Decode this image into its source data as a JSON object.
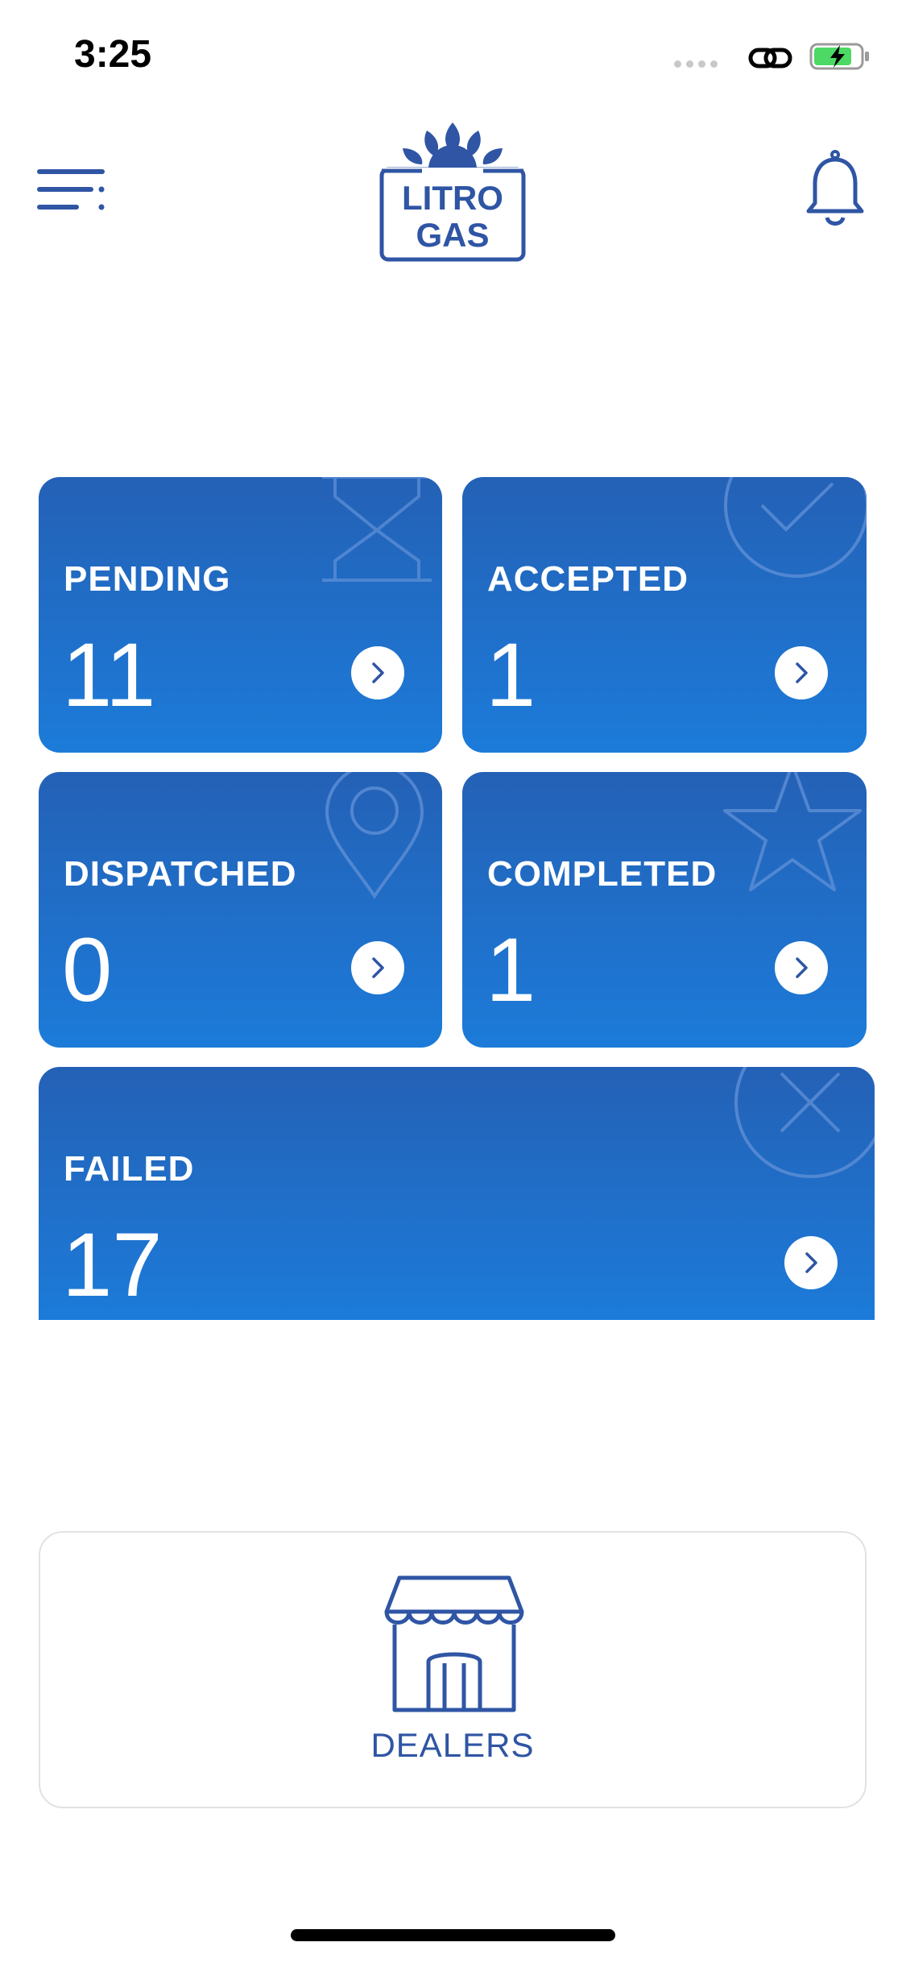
{
  "status_bar": {
    "time": "3:25"
  },
  "header": {
    "logo_text_line1": "LITRO",
    "logo_text_line2": "GAS",
    "menu_icon": "menu-icon",
    "notifications_icon": "bell-icon"
  },
  "tiles": [
    {
      "label": "PENDING",
      "count": "11",
      "icon": "hourglass-icon"
    },
    {
      "label": "ACCEPTED",
      "count": "1",
      "icon": "check-circle-icon"
    },
    {
      "label": "DISPATCHED",
      "count": "0",
      "icon": "map-pin-icon"
    },
    {
      "label": "COMPLETED",
      "count": "1",
      "icon": "star-icon"
    },
    {
      "label": "FAILED",
      "count": "17",
      "icon": "x-circle-icon"
    }
  ],
  "dealers": {
    "label": "DEALERS",
    "icon": "store-icon"
  },
  "colors": {
    "brand_blue": "#2f55a4",
    "tile_top": "#2461b6",
    "tile_bottom": "#1c7bd9",
    "battery_green": "#4cd964"
  }
}
